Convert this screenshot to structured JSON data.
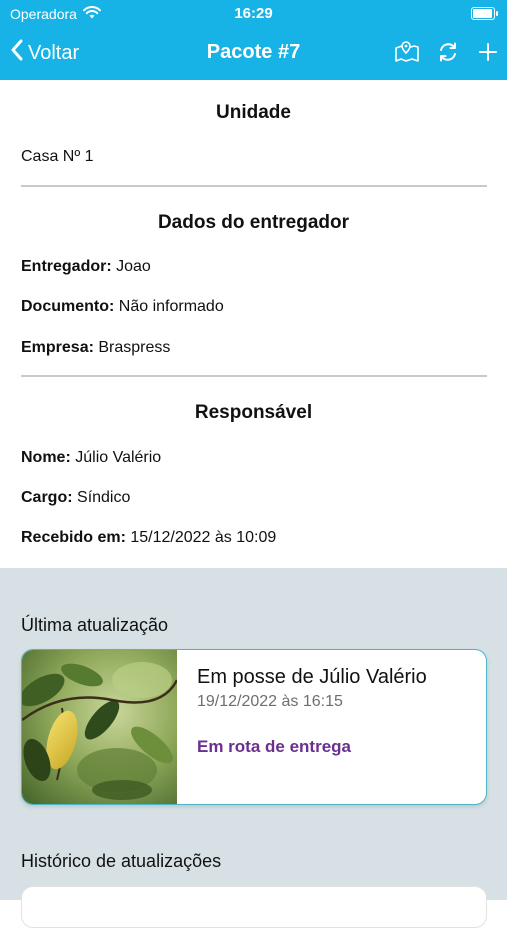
{
  "status_bar": {
    "carrier": "Operadora",
    "time": "16:29"
  },
  "nav": {
    "back_label": "Voltar",
    "title": "Pacote #7"
  },
  "unit": {
    "heading": "Unidade",
    "value": "Casa Nº 1"
  },
  "deliverer": {
    "heading": "Dados do entregador",
    "name_label": "Entregador:",
    "name_value": "Joao",
    "document_label": "Documento:",
    "document_value": "Não informado",
    "company_label": "Empresa:",
    "company_value": "Braspress"
  },
  "responsible": {
    "heading": "Responsável",
    "name_label": "Nome:",
    "name_value": "Júlio Valério",
    "role_label": "Cargo:",
    "role_value": "Síndico",
    "received_label": "Recebido em:",
    "received_value": "15/12/2022 às 10:09"
  },
  "last_update": {
    "heading": "Última atualização",
    "title": "Em posse de Júlio Valério",
    "date": "19/12/2022 às 16:15",
    "status": "Em rota de entrega"
  },
  "history": {
    "heading": "Histórico de atualizações"
  },
  "colors": {
    "brand": "#18b3e6",
    "status_text": "#6b2f8f",
    "card_border": "#4ab7c8",
    "gray_area": "#d7e1e5"
  },
  "icons": [
    "wifi-icon",
    "battery-icon",
    "chevron-left-icon",
    "map-icon",
    "refresh-icon",
    "plus-icon"
  ]
}
